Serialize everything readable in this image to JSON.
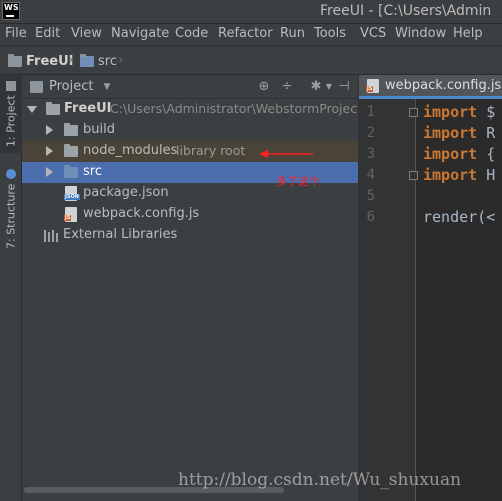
{
  "window": {
    "logo_text": "WS",
    "title": "FreeUI - [C:\\Users\\Admin"
  },
  "menu": [
    "File",
    "Edit",
    "View",
    "Navigate",
    "Code",
    "Refactor",
    "Run",
    "Tools",
    "VCS",
    "Window",
    "Help"
  ],
  "breadcrumb": [
    "FreeUI",
    "src"
  ],
  "tool_strip": {
    "project_tab": "1: Project",
    "structure_tab": "7: Structure"
  },
  "project_panel": {
    "view_label": "Project",
    "tools": [
      "globe-icon",
      "collapse-icon",
      "gear-icon",
      "hide-icon"
    ],
    "tree": [
      {
        "label": "FreeUI",
        "hint": "C:\\Users\\Administrator\\WebstormProjects\\",
        "icon": "folder-icon",
        "expanded": true
      },
      {
        "label": "build",
        "icon": "folder-icon",
        "expanded": false
      },
      {
        "label": "node_modules",
        "hint": "library root",
        "icon": "folder-icon",
        "expanded": false
      },
      {
        "label": "src",
        "icon": "folder-icon",
        "expanded": false,
        "selected": true
      },
      {
        "label": "package.json",
        "icon": "json-file-icon"
      },
      {
        "label": "webpack.config.js",
        "icon": "js-file-icon"
      },
      {
        "label": "External Libraries",
        "icon": "library-icon"
      }
    ],
    "annotation_text": "多了这个"
  },
  "editor": {
    "tab_label": "webpack.config.js",
    "line_numbers": [
      "1",
      "2",
      "3",
      "4",
      "5",
      "6"
    ],
    "lines": [
      {
        "kw": "import",
        "rest": " $"
      },
      {
        "kw": "import",
        "rest": " R"
      },
      {
        "kw": "import",
        "rest": " {"
      },
      {
        "kw": "import",
        "rest": " H"
      },
      {
        "kw": "",
        "rest": ""
      },
      {
        "kw": "",
        "rest": "render(<"
      }
    ]
  },
  "watermark": "http://blog.csdn.net/Wu_shuxuan",
  "colors": {
    "selection": "#4b6eaf",
    "library_root_row": "#4a4338",
    "keyword": "#cc7832",
    "annotation": "#ff2020"
  }
}
